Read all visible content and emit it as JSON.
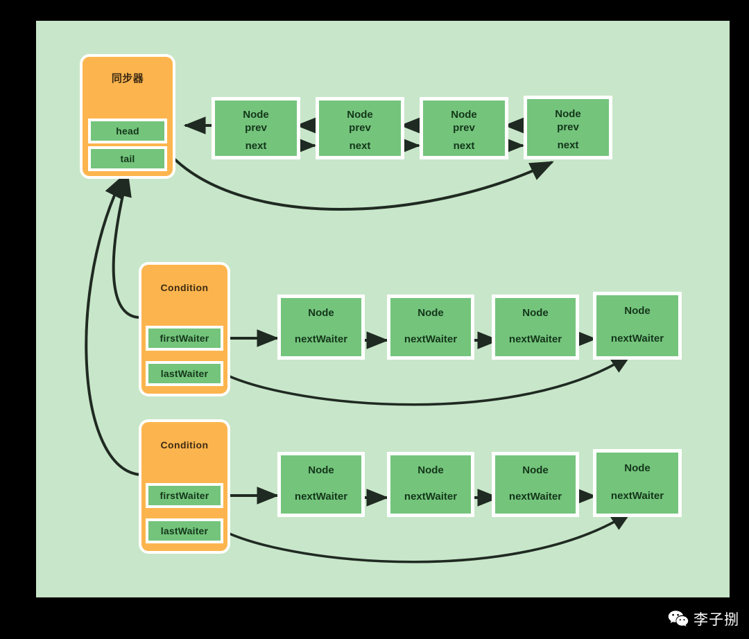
{
  "canvas": {
    "background_color": "#c8e6c9",
    "page_background_color": "#000000",
    "orange_color": "#fcb54e",
    "green_color": "#74c47c",
    "arrow_color": "#1f2a22"
  },
  "synchronizer": {
    "title": "同步器",
    "fields": [
      {
        "label": "head"
      },
      {
        "label": "tail"
      }
    ]
  },
  "aqs_queue": {
    "nodes": [
      {
        "title": "Node",
        "prev": "prev",
        "next": "next"
      },
      {
        "title": "Node",
        "prev": "prev",
        "next": "next"
      },
      {
        "title": "Node",
        "prev": "prev",
        "next": "next"
      },
      {
        "title": "Node",
        "prev": "prev",
        "next": "next"
      }
    ]
  },
  "conditions": [
    {
      "title": "Condition",
      "fields": [
        {
          "label": "firstWaiter"
        },
        {
          "label": "lastWaiter"
        }
      ],
      "nodes": [
        {
          "title": "Node",
          "next_waiter": "nextWaiter"
        },
        {
          "title": "Node",
          "next_waiter": "nextWaiter"
        },
        {
          "title": "Node",
          "next_waiter": "nextWaiter"
        },
        {
          "title": "Node",
          "next_waiter": "nextWaiter"
        }
      ]
    },
    {
      "title": "Condition",
      "fields": [
        {
          "label": "firstWaiter"
        },
        {
          "label": "lastWaiter"
        }
      ],
      "nodes": [
        {
          "title": "Node",
          "next_waiter": "nextWaiter"
        },
        {
          "title": "Node",
          "next_waiter": "nextWaiter"
        },
        {
          "title": "Node",
          "next_waiter": "nextWaiter"
        },
        {
          "title": "Node",
          "next_waiter": "nextWaiter"
        }
      ]
    }
  ],
  "watermark": {
    "icon": "wechat-icon",
    "text": "李子捌"
  }
}
